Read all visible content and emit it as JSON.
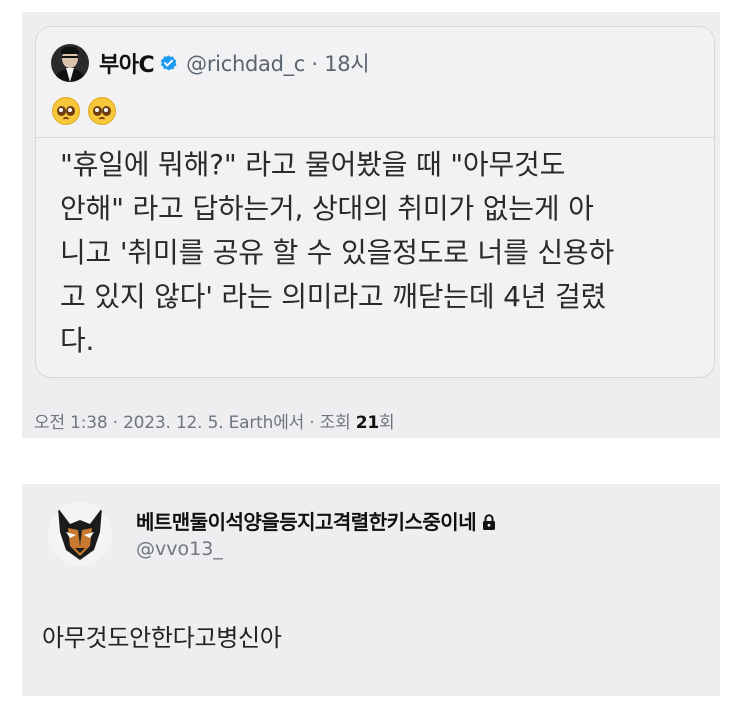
{
  "quoted_tweet": {
    "author_name": "부아C",
    "handle": "@richdad_c",
    "time_ago": "18시",
    "emojis": [
      "pleading-face-emoji",
      "pleading-face-emoji"
    ],
    "body_lines": [
      "\"휴일에 뭐해?\" 라고 물어봤을 때 \"아무것도",
      "안해\" 라고 답하는거, 상대의 취미가 없는게 아",
      "니고 '취미를 공유 할 수 있을정도로 너를 신용하",
      "고 있지 않다' 라는 의미라고 깨닫는데 4년 걸렸",
      "다."
    ]
  },
  "meta": {
    "prefix": "오전 1:38 · 2023. 12. 5. Earth에서 · 조회 ",
    "views": "21",
    "suffix": "회"
  },
  "reply": {
    "author_name": "베트맨둘이석양을등지고격렬한키스중이네",
    "handle": "@vvo13_",
    "body": "아무것도안한다고병신아"
  },
  "colors": {
    "panel_bg": "#eeeef0",
    "verified_blue": "#1d9bf0",
    "secondary_text": "#6e7680"
  }
}
